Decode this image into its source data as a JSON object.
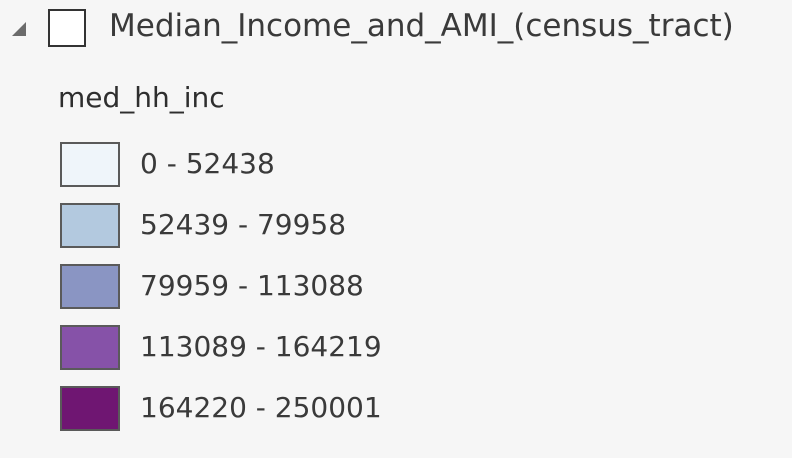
{
  "layer": {
    "name": "Median_Income_and_AMI_(census_tract)",
    "visible": false,
    "expanded": true,
    "expander_icon": "triangle-expanded-icon"
  },
  "legend": {
    "field": "med_hh_inc",
    "classes": [
      {
        "label": "0 - 52438",
        "color": "#eff5fa"
      },
      {
        "label": "52439 - 79958",
        "color": "#b3c9df"
      },
      {
        "label": "79959 - 113088",
        "color": "#8a95c3"
      },
      {
        "label": "113089 - 164219",
        "color": "#8652a8"
      },
      {
        "label": "164220 - 250001",
        "color": "#6f1672"
      }
    ]
  }
}
